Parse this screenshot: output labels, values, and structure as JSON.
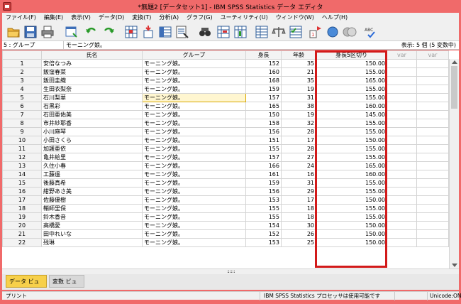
{
  "window": {
    "title": "*無題2 [データセット1] - IBM SPSS Statistics データ エディタ"
  },
  "menu": [
    "ファイル(F)",
    "編集(E)",
    "表示(V)",
    "データ(D)",
    "変換(T)",
    "分析(A)",
    "グラフ(G)",
    "ユーティリティ(U)",
    "ウィンドウ(W)",
    "ヘルプ(H)"
  ],
  "toolbar_icons": [
    "open-folder-icon",
    "save-icon",
    "print-icon",
    "dialog-recall-icon",
    "undo-icon",
    "redo-icon",
    "goto-case-icon",
    "goto-variable-icon",
    "variables-icon",
    "run-descriptives-icon",
    "find-icon",
    "insert-cases-icon",
    "insert-variable-icon",
    "split-file-icon",
    "weight-cases-icon",
    "select-cases-icon",
    "value-labels-icon",
    "use-variable-sets-icon",
    "show-all-variables-icon",
    "spell-check-icon"
  ],
  "cellbar": {
    "ref": "5 : グループ",
    "value": "モーニング娘。",
    "status": "表示: 5 個 (5 変数中)"
  },
  "grid": {
    "columns": [
      "氏名",
      "グループ",
      "身長",
      "年齢",
      "身長5区切り",
      "var",
      "var"
    ],
    "rows": [
      [
        "1",
        "安倍なつみ",
        "モーニング娘。",
        "152",
        "35",
        "150.00"
      ],
      [
        "2",
        "飯窪春菜",
        "モーニング娘。",
        "160",
        "21",
        "155.00"
      ],
      [
        "3",
        "飯田圭織",
        "モーニング娘。",
        "168",
        "35",
        "165.00"
      ],
      [
        "4",
        "生田衣梨奈",
        "モーニング娘。",
        "159",
        "19",
        "155.00"
      ],
      [
        "5",
        "石川梨華",
        "モーニング娘。",
        "157",
        "31",
        "155.00"
      ],
      [
        "6",
        "石黒彩",
        "モーニング娘。",
        "165",
        "38",
        "160.00"
      ],
      [
        "7",
        "石田亜佑美",
        "モーニング娘。",
        "150",
        "19",
        "145.00"
      ],
      [
        "8",
        "市井紗耶香",
        "モーニング娘。",
        "158",
        "32",
        "155.00"
      ],
      [
        "9",
        "小川麻琴",
        "モーニング娘。",
        "156",
        "28",
        "155.00"
      ],
      [
        "10",
        "小田さくら",
        "モーニング娘。",
        "151",
        "17",
        "150.00"
      ],
      [
        "11",
        "加護亜依",
        "モーニング娘。",
        "155",
        "28",
        "155.00"
      ],
      [
        "12",
        "亀井絵里",
        "モーニング娘。",
        "157",
        "27",
        "155.00"
      ],
      [
        "13",
        "久住小春",
        "モーニング娘。",
        "166",
        "24",
        "165.00"
      ],
      [
        "14",
        "工藤遥",
        "モーニング娘。",
        "161",
        "16",
        "160.00"
      ],
      [
        "15",
        "後藤真希",
        "モーニング娘。",
        "159",
        "31",
        "155.00"
      ],
      [
        "16",
        "紺野あさ美",
        "モーニング娘。",
        "156",
        "29",
        "155.00"
      ],
      [
        "17",
        "佐藤優樹",
        "モーニング娘。",
        "153",
        "17",
        "150.00"
      ],
      [
        "18",
        "鞘師里保",
        "モーニング娘。",
        "155",
        "18",
        "155.00"
      ],
      [
        "19",
        "鈴木香音",
        "モーニング娘。",
        "155",
        "18",
        "155.00"
      ],
      [
        "20",
        "高橋愛",
        "モーニング娘。",
        "154",
        "30",
        "150.00"
      ],
      [
        "21",
        "田中れいな",
        "モーニング娘。",
        "152",
        "26",
        "150.00"
      ],
      [
        "22",
        "残琳",
        "モーニング娘。",
        "153",
        "25",
        "150.00"
      ]
    ]
  },
  "tabs": {
    "data_view": "データ ビュー",
    "variable_view": "変数 ビュー"
  },
  "status": {
    "left": "プリント",
    "processor": "IBM SPSS Statistics プロセッサは使用可能です",
    "unicode": "Unicode:ON"
  },
  "colors": {
    "titlebar": "#f06a6a",
    "highlight": "#d21a1a",
    "active_tab": "#f7d04a"
  }
}
